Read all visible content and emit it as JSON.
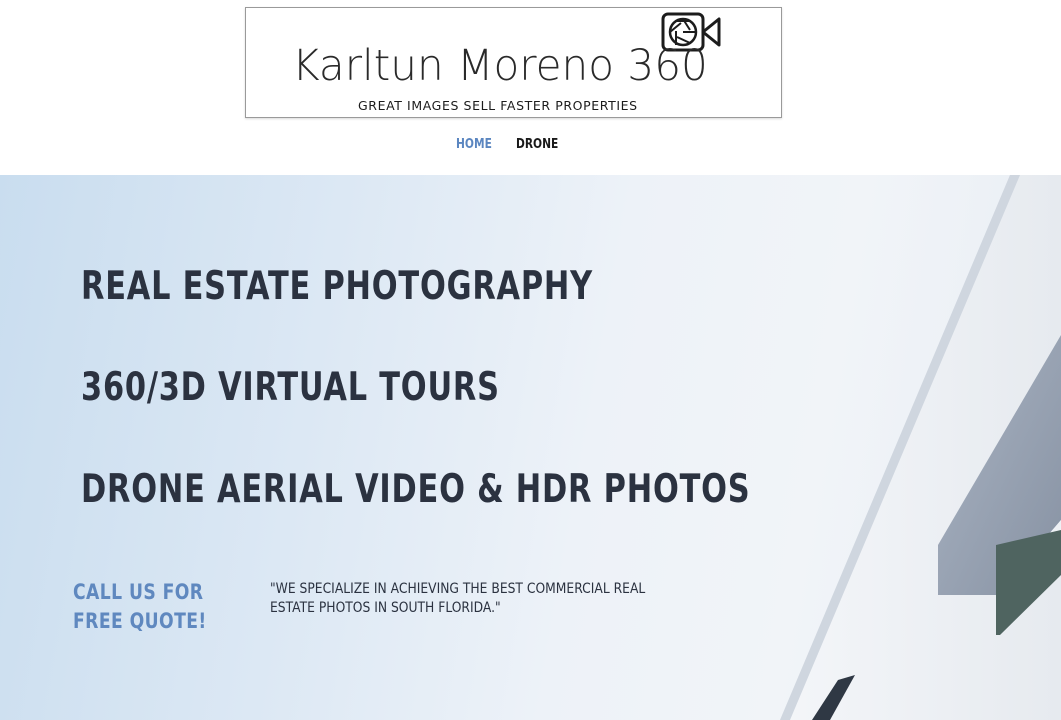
{
  "logo": {
    "title": "Karltun Moreno 360",
    "tagline": "GREAT IMAGES SELL FASTER PROPERTIES",
    "icon": "video-camera-aperture-icon"
  },
  "nav": {
    "items": [
      {
        "label": "HOME",
        "active": true
      },
      {
        "label": "DRONE",
        "active": false
      }
    ]
  },
  "hero": {
    "headlines": [
      "REAL ESTATE PHOTOGRAPHY",
      "360/3D VIRTUAL TOURS",
      "DRONE AERIAL VIDEO & HDR PHOTOS"
    ],
    "cta": "CALL US FOR FREE QUOTE!",
    "quote": "\"WE SPECIALIZE IN ACHIEVING THE BEST COMMERCIAL REAL ESTATE PHOTOS IN SOUTH FLORIDA.\""
  },
  "colors": {
    "accent": "#5f88bf",
    "nav_active": "#5b86c0",
    "headline": "#2b3240"
  }
}
